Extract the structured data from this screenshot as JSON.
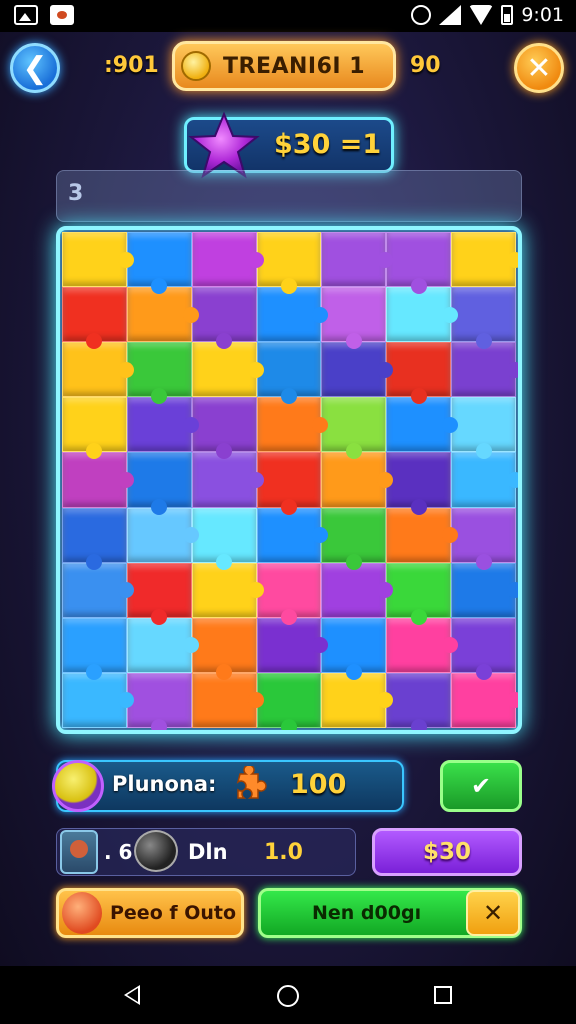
{
  "status_bar": {
    "time": "9:01"
  },
  "hud": {
    "left_value": ":901",
    "title": "TREANI6I 1",
    "right_value": "90",
    "back_icon": "chevron-left-icon",
    "close_icon": "close-icon"
  },
  "score": {
    "text": "$30 =1"
  },
  "info": {
    "value": "3"
  },
  "board": {
    "rows": 9,
    "cols": 7,
    "tiles": [
      "#ffd21a",
      "#1e90ff",
      "#c040e0",
      "#ffd21a",
      "#a050e0",
      "#a050e0",
      "#ffd21a",
      "#f03020",
      "#ff9a1a",
      "#8a40d0",
      "#1e90ff",
      "#c060e8",
      "#66e8ff",
      "#6060e0",
      "#ffc21a",
      "#3ac83a",
      "#ffd21a",
      "#1e8ae8",
      "#4a40c8",
      "#e83020",
      "#7a40d0",
      "#ffd21a",
      "#6a40d8",
      "#8a40d0",
      "#ff7a1a",
      "#8ae040",
      "#1e90ff",
      "#66d8ff",
      "#c040c0",
      "#1e7ae8",
      "#8a50e0",
      "#f03020",
      "#ff9a1a",
      "#5a30c0",
      "#3ab8ff",
      "#2a6ae0",
      "#66c8ff",
      "#66e8ff",
      "#1e90ff",
      "#3ac83a",
      "#ff7a1a",
      "#9a50e0",
      "#3a90f0",
      "#f02a2a",
      "#ffd21a",
      "#ff4aa0",
      "#a040e0",
      "#3ad83a",
      "#1e7ae8",
      "#2aa0ff",
      "#66d8ff",
      "#ff7a1a",
      "#7a30d0",
      "#1e90ff",
      "#ff40a0",
      "#7a40d8",
      "#3ab8ff",
      "#a050e0",
      "#ff7a1a",
      "#2ac83a",
      "#ffd21a",
      "#6a40d0",
      "#ff40a0"
    ]
  },
  "power": {
    "label": "Plunona:",
    "count": "100",
    "confirm_icon": "check-icon"
  },
  "stats": {
    "small": ". 6",
    "label": "Dln",
    "value": "1.0",
    "buy_label": "$30"
  },
  "actions": {
    "left_label": "Peeo f Outo",
    "right_label": "Nen d00gı",
    "close_icon": "close-icon"
  },
  "colors": {
    "accent_cyan": "#8ff6ff",
    "gold": "#ffd23a",
    "purple": "#b25aff",
    "green": "#34e84a",
    "orange": "#ffc24a"
  }
}
